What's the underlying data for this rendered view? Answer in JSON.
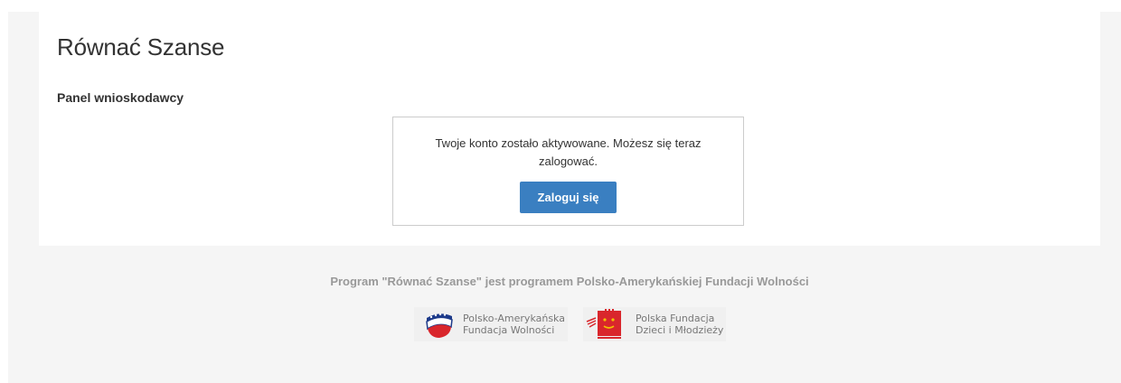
{
  "header": {
    "title": "Równać Szanse"
  },
  "panel": {
    "title": "Panel wnioskodawcy"
  },
  "activation": {
    "message": "Twoje konto zostało aktywowane. Możesz się teraz zalogować.",
    "login_label": "Zaloguj się",
    "button_color": "#3a7fc1"
  },
  "footer": {
    "program_text": "Program \"Równać Szanse\" jest programem Polsko-Amerykańskiej Fundacji Wolności",
    "logos": [
      {
        "icon": "pafw-logo-icon",
        "line1": "Polsko-Amerykańska",
        "line2": "Fundacja Wolności"
      },
      {
        "icon": "pfdim-logo-icon",
        "line1": "Polska Fundacja",
        "line2": "Dzieci i Młodzieży"
      }
    ]
  }
}
